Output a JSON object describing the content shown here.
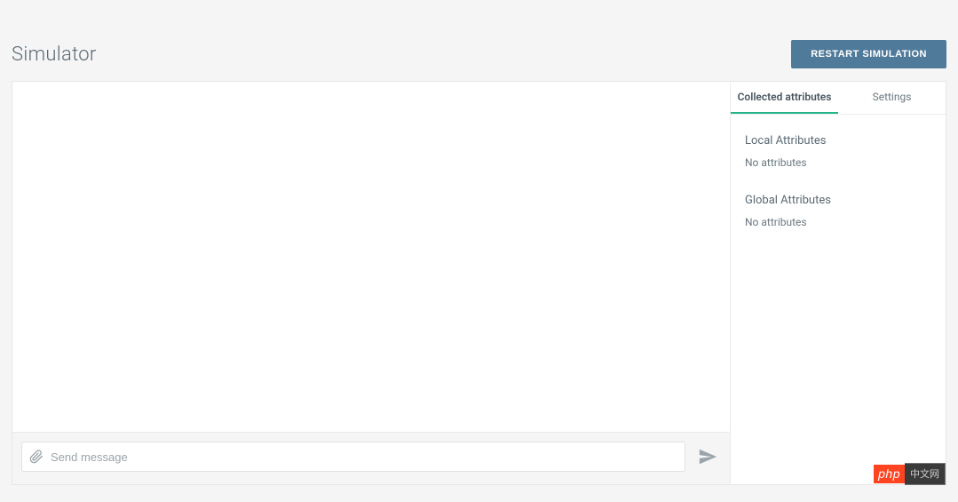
{
  "header": {
    "title": "Simulator",
    "restart_button_label": "RESTART SIMULATION"
  },
  "chat": {
    "input_placeholder": "Send message"
  },
  "side_panel": {
    "tabs": {
      "collected": "Collected attributes",
      "settings": "Settings"
    },
    "sections": {
      "local": {
        "heading": "Local Attributes",
        "empty_text": "No attributes"
      },
      "global": {
        "heading": "Global Attributes",
        "empty_text": "No attributes"
      }
    }
  },
  "watermark": {
    "left": "php",
    "right": "中文网"
  }
}
